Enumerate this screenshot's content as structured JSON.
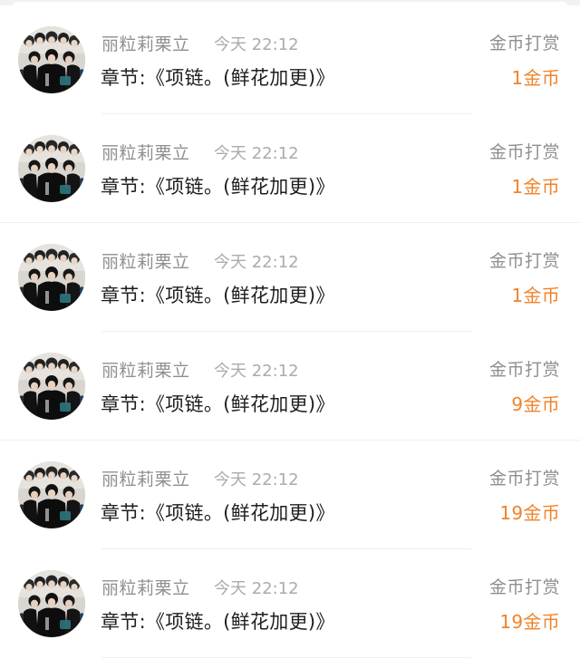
{
  "rewards": [
    {
      "username": "丽粒莉栗立",
      "time": "今天 22:12",
      "chapter": "章节:《项链。(鲜花加更)》",
      "tip_label": "金币打赏",
      "amount": "1金币"
    },
    {
      "username": "丽粒莉栗立",
      "time": "今天 22:12",
      "chapter": "章节:《项链。(鲜花加更)》",
      "tip_label": "金币打赏",
      "amount": "1金币"
    },
    {
      "username": "丽粒莉栗立",
      "time": "今天 22:12",
      "chapter": "章节:《项链。(鲜花加更)》",
      "tip_label": "金币打赏",
      "amount": "1金币"
    },
    {
      "username": "丽粒莉栗立",
      "time": "今天 22:12",
      "chapter": "章节:《项链。(鲜花加更)》",
      "tip_label": "金币打赏",
      "amount": "9金币"
    },
    {
      "username": "丽粒莉栗立",
      "time": "今天 22:12",
      "chapter": "章节:《项链。(鲜花加更)》",
      "tip_label": "金币打赏",
      "amount": "19金币"
    },
    {
      "username": "丽粒莉栗立",
      "time": "今天 22:12",
      "chapter": "章节:《项链。(鲜花加更)》",
      "tip_label": "金币打赏",
      "amount": "19金币"
    }
  ],
  "colors": {
    "amount": "#f0832a",
    "secondary_text": "#8f8f8f",
    "primary_text": "#1e1e1e"
  },
  "icons": {
    "avatar": "group-photo-avatar"
  }
}
